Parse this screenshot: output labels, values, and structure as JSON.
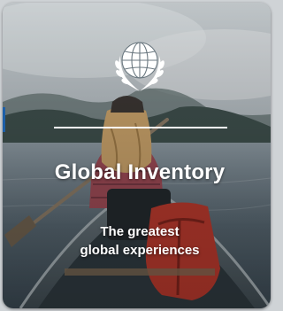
{
  "card": {
    "title": "Global Inventory",
    "subtitle_line1": "The greatest",
    "subtitle_line2": "global experiences",
    "logo_icon": "un-globe-laurel-icon",
    "background": "woman-in-canoe-on-misty-lake-photo"
  },
  "colors": {
    "text": "#ffffff",
    "accent": "#1d5fa8",
    "page_bg": "#cfd3d6"
  }
}
